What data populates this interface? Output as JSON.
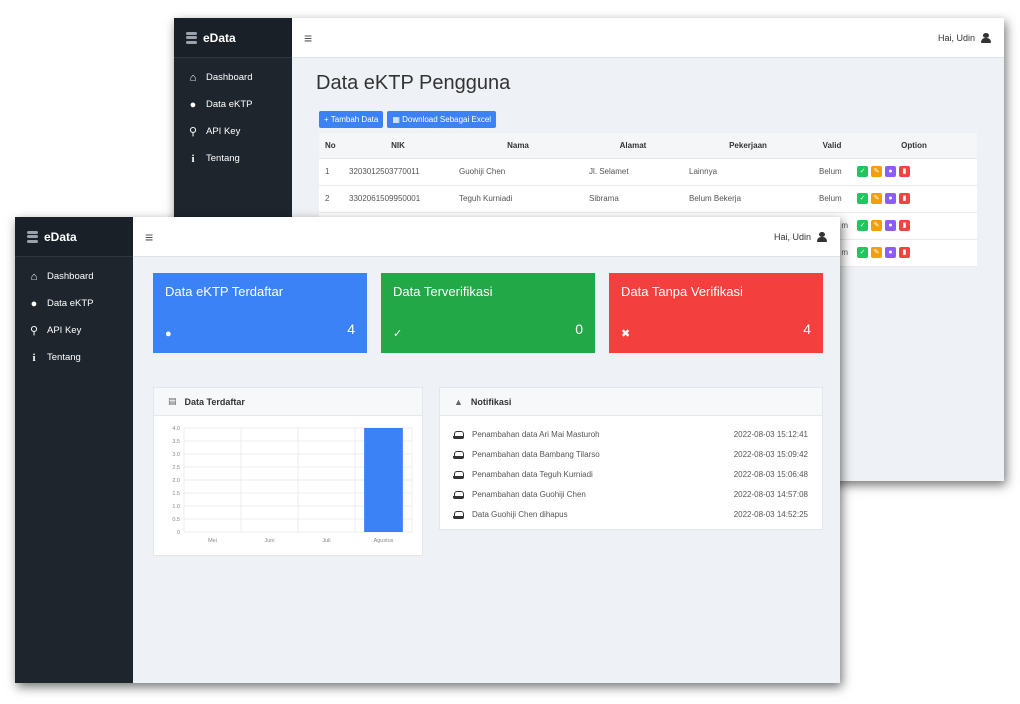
{
  "app": {
    "brand": "eData",
    "greeting": "Hai, Udin"
  },
  "sidebar": {
    "items": [
      {
        "label": "Dashboard",
        "icon": "home-icon"
      },
      {
        "label": "Data eKTP",
        "icon": "users-icon"
      },
      {
        "label": "API Key",
        "icon": "key-icon"
      },
      {
        "label": "Tentang",
        "icon": "info-icon"
      }
    ]
  },
  "data_page": {
    "title": "Data eKTP Pengguna",
    "add_button": "Tambah Data",
    "download_button": "Download Sebagai Excel",
    "columns": [
      "No",
      "NIK",
      "Nama",
      "Alamat",
      "Pekerjaan",
      "Valid",
      "Option"
    ],
    "rows": [
      {
        "no": "1",
        "nik": "3203012503770011",
        "nama": "Guohiji Chen",
        "alamat": "Jl. Selamet",
        "pekerjaan": "Lainnya",
        "valid": "Belum"
      },
      {
        "no": "2",
        "nik": "3302061509950001",
        "nama": "Teguh Kurniadi",
        "alamat": "Sibrama",
        "pekerjaan": "Belum Bekerja",
        "valid": "Belum"
      },
      {
        "no": "",
        "nik": "",
        "nama": "",
        "alamat": "",
        "pekerjaan": "",
        "valid": "m"
      },
      {
        "no": "",
        "nik": "",
        "nama": "",
        "alamat": "",
        "pekerjaan": "",
        "valid": "m"
      }
    ],
    "action_colors": [
      "#22c55e",
      "#f59e0b",
      "#8b5cf6",
      "#ef4444"
    ]
  },
  "dashboard": {
    "cards": [
      {
        "title": "Data eKTP Terdaftar",
        "count": "4",
        "icon": "user-icon",
        "color": "#3b82f6"
      },
      {
        "title": "Data Terverifikasi",
        "count": "0",
        "icon": "check-icon",
        "color": "#22a846"
      },
      {
        "title": "Data Tanpa Verifikasi",
        "count": "4",
        "icon": "times-circle-icon",
        "color": "#f43f3f"
      }
    ],
    "chart_panel_title": "Data Terdaftar",
    "notif_panel_title": "Notifikasi",
    "notifications": [
      {
        "text": "Penambahan data Ari Mai Masturoh",
        "time": "2022-08-03 15:12:41"
      },
      {
        "text": "Penambahan data Bambang Tilarso",
        "time": "2022-08-03 15:09:42"
      },
      {
        "text": "Penambahan data Teguh Kurniadi",
        "time": "2022-08-03 15:06:48"
      },
      {
        "text": "Penambahan data Guohiji Chen",
        "time": "2022-08-03 14:57:08"
      },
      {
        "text": "Data Guohiji Chen dihapus",
        "time": "2022-08-03 14:52:25"
      }
    ]
  },
  "chart_data": {
    "type": "bar",
    "categories": [
      "Mei",
      "Juni",
      "Juli",
      "Agustus"
    ],
    "values": [
      0,
      0,
      0,
      4
    ],
    "yticks": [
      "0",
      "0.5",
      "1.0",
      "1.5",
      "2.0",
      "2.5",
      "3.0",
      "3.5",
      "4.0"
    ],
    "ylim": [
      0,
      4
    ],
    "color": "#3b82f6",
    "grid": true
  }
}
